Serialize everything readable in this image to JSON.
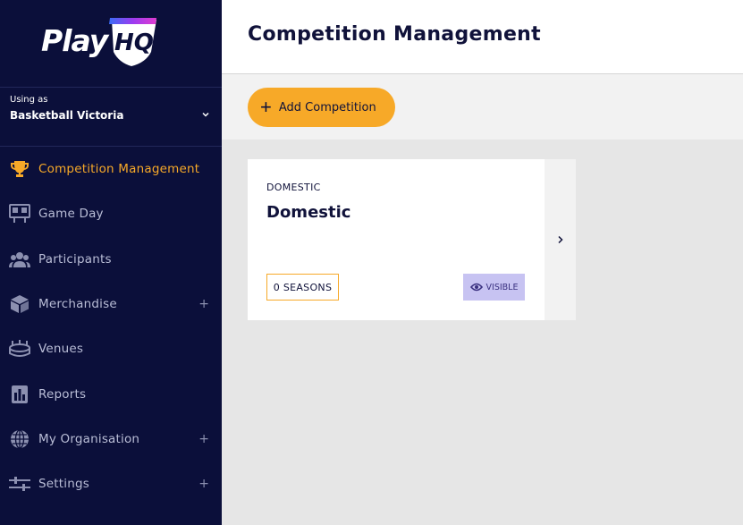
{
  "logo": {
    "text": "Play",
    "hq": "HQ"
  },
  "org": {
    "using_label": "Using as",
    "name": "Basketball Victoria"
  },
  "nav": [
    {
      "label": "Competition Management",
      "icon": "trophy-icon",
      "active": true,
      "expandable": false
    },
    {
      "label": "Game Day",
      "icon": "scoreboard-icon",
      "active": false,
      "expandable": false
    },
    {
      "label": "Participants",
      "icon": "people-icon",
      "active": false,
      "expandable": false
    },
    {
      "label": "Merchandise",
      "icon": "box-icon",
      "active": false,
      "expandable": true
    },
    {
      "label": "Venues",
      "icon": "stadium-icon",
      "active": false,
      "expandable": false
    },
    {
      "label": "Reports",
      "icon": "report-icon",
      "active": false,
      "expandable": false
    },
    {
      "label": "My Organisation",
      "icon": "globe-icon",
      "active": false,
      "expandable": true
    },
    {
      "label": "Settings",
      "icon": "sliders-icon",
      "active": false,
      "expandable": true
    }
  ],
  "expand_symbol": "+",
  "header": {
    "title": "Competition Management"
  },
  "toolbar": {
    "add_label": "Add Competition",
    "add_symbol": "+"
  },
  "cards": [
    {
      "type": "DOMESTIC",
      "title": "Domestic",
      "seasons": "0 SEASONS",
      "visibility": "VISIBLE"
    }
  ],
  "colors": {
    "sidebar": "#0b0f3a",
    "accent": "#f7a928",
    "badge": "#c7c3f2",
    "text_dark": "#10123a"
  }
}
